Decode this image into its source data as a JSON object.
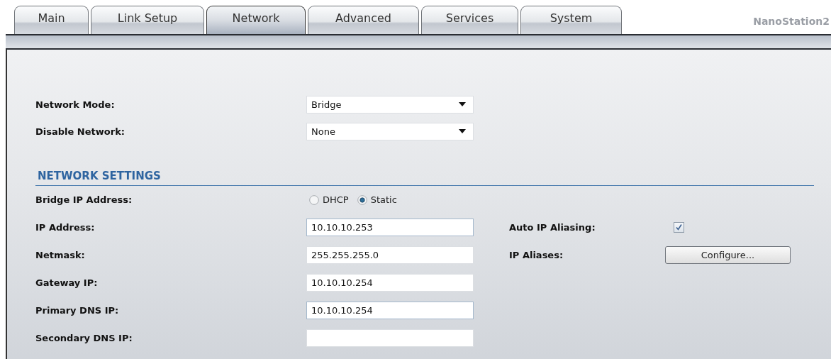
{
  "tabs": [
    {
      "label": "Main",
      "selected": false
    },
    {
      "label": "Link Setup",
      "selected": false
    },
    {
      "label": "Network",
      "selected": true
    },
    {
      "label": "Advanced",
      "selected": false
    },
    {
      "label": "Services",
      "selected": false
    },
    {
      "label": "System",
      "selected": false
    }
  ],
  "device_name": "NanoStation2",
  "top_fields": [
    {
      "label": "Network Mode:",
      "kind": "select",
      "value": "Bridge"
    },
    {
      "label": "Disable Network:",
      "kind": "select",
      "value": "None"
    }
  ],
  "section": {
    "title": "NETWORK SETTINGS"
  },
  "fields": [
    {
      "label": "Bridge IP Address:",
      "kind": "radio",
      "options": [
        {
          "label": "DHCP",
          "selected": false
        },
        {
          "label": "Static",
          "selected": true
        }
      ]
    },
    {
      "label": "IP Address:",
      "kind": "text",
      "value": "10.10.10.253",
      "focused": true,
      "side": {
        "label": "Auto IP Aliasing:",
        "kind": "checkbox",
        "checked": true
      }
    },
    {
      "label": "Netmask:",
      "kind": "text",
      "value": "255.255.255.0",
      "focused": false,
      "side": {
        "label": "IP Aliases:",
        "kind": "button",
        "button": "Configure..."
      }
    },
    {
      "label": "Gateway IP:",
      "kind": "text",
      "value": "10.10.10.254",
      "focused": false
    },
    {
      "label": "Primary DNS IP:",
      "kind": "text",
      "value": "10.10.10.254",
      "focused": true
    },
    {
      "label": "Secondary DNS IP:",
      "kind": "text",
      "focused": false
    }
  ]
}
